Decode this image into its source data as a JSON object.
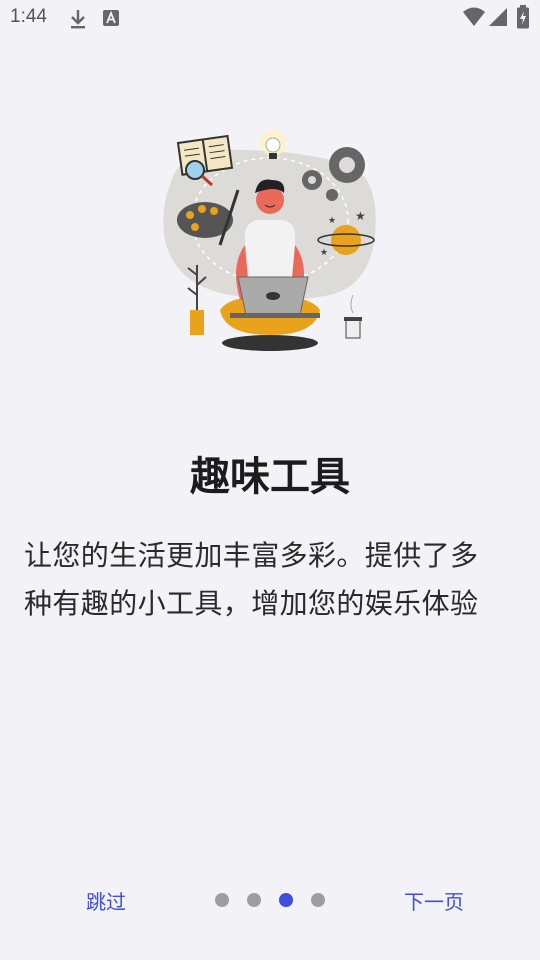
{
  "status_bar": {
    "time": "1:44",
    "icons": [
      "download-icon",
      "font-a-icon",
      "wifi-icon",
      "cell-signal-icon",
      "battery-charging-icon"
    ]
  },
  "onboarding": {
    "illustration": "person-with-laptop-hobbies-illustration",
    "title": "趣味工具",
    "description_line1": "让您的生活更加丰富多彩。提供了多",
    "description_line2": "种有趣的小工具，增加您的娱乐体验",
    "skip_label": "跳过",
    "next_label": "下一页",
    "page_count": 4,
    "current_page": 3
  },
  "colors": {
    "background": "#f2f2f7",
    "accent": "#3f4ee0",
    "dot_inactive": "#9e9e9e"
  }
}
